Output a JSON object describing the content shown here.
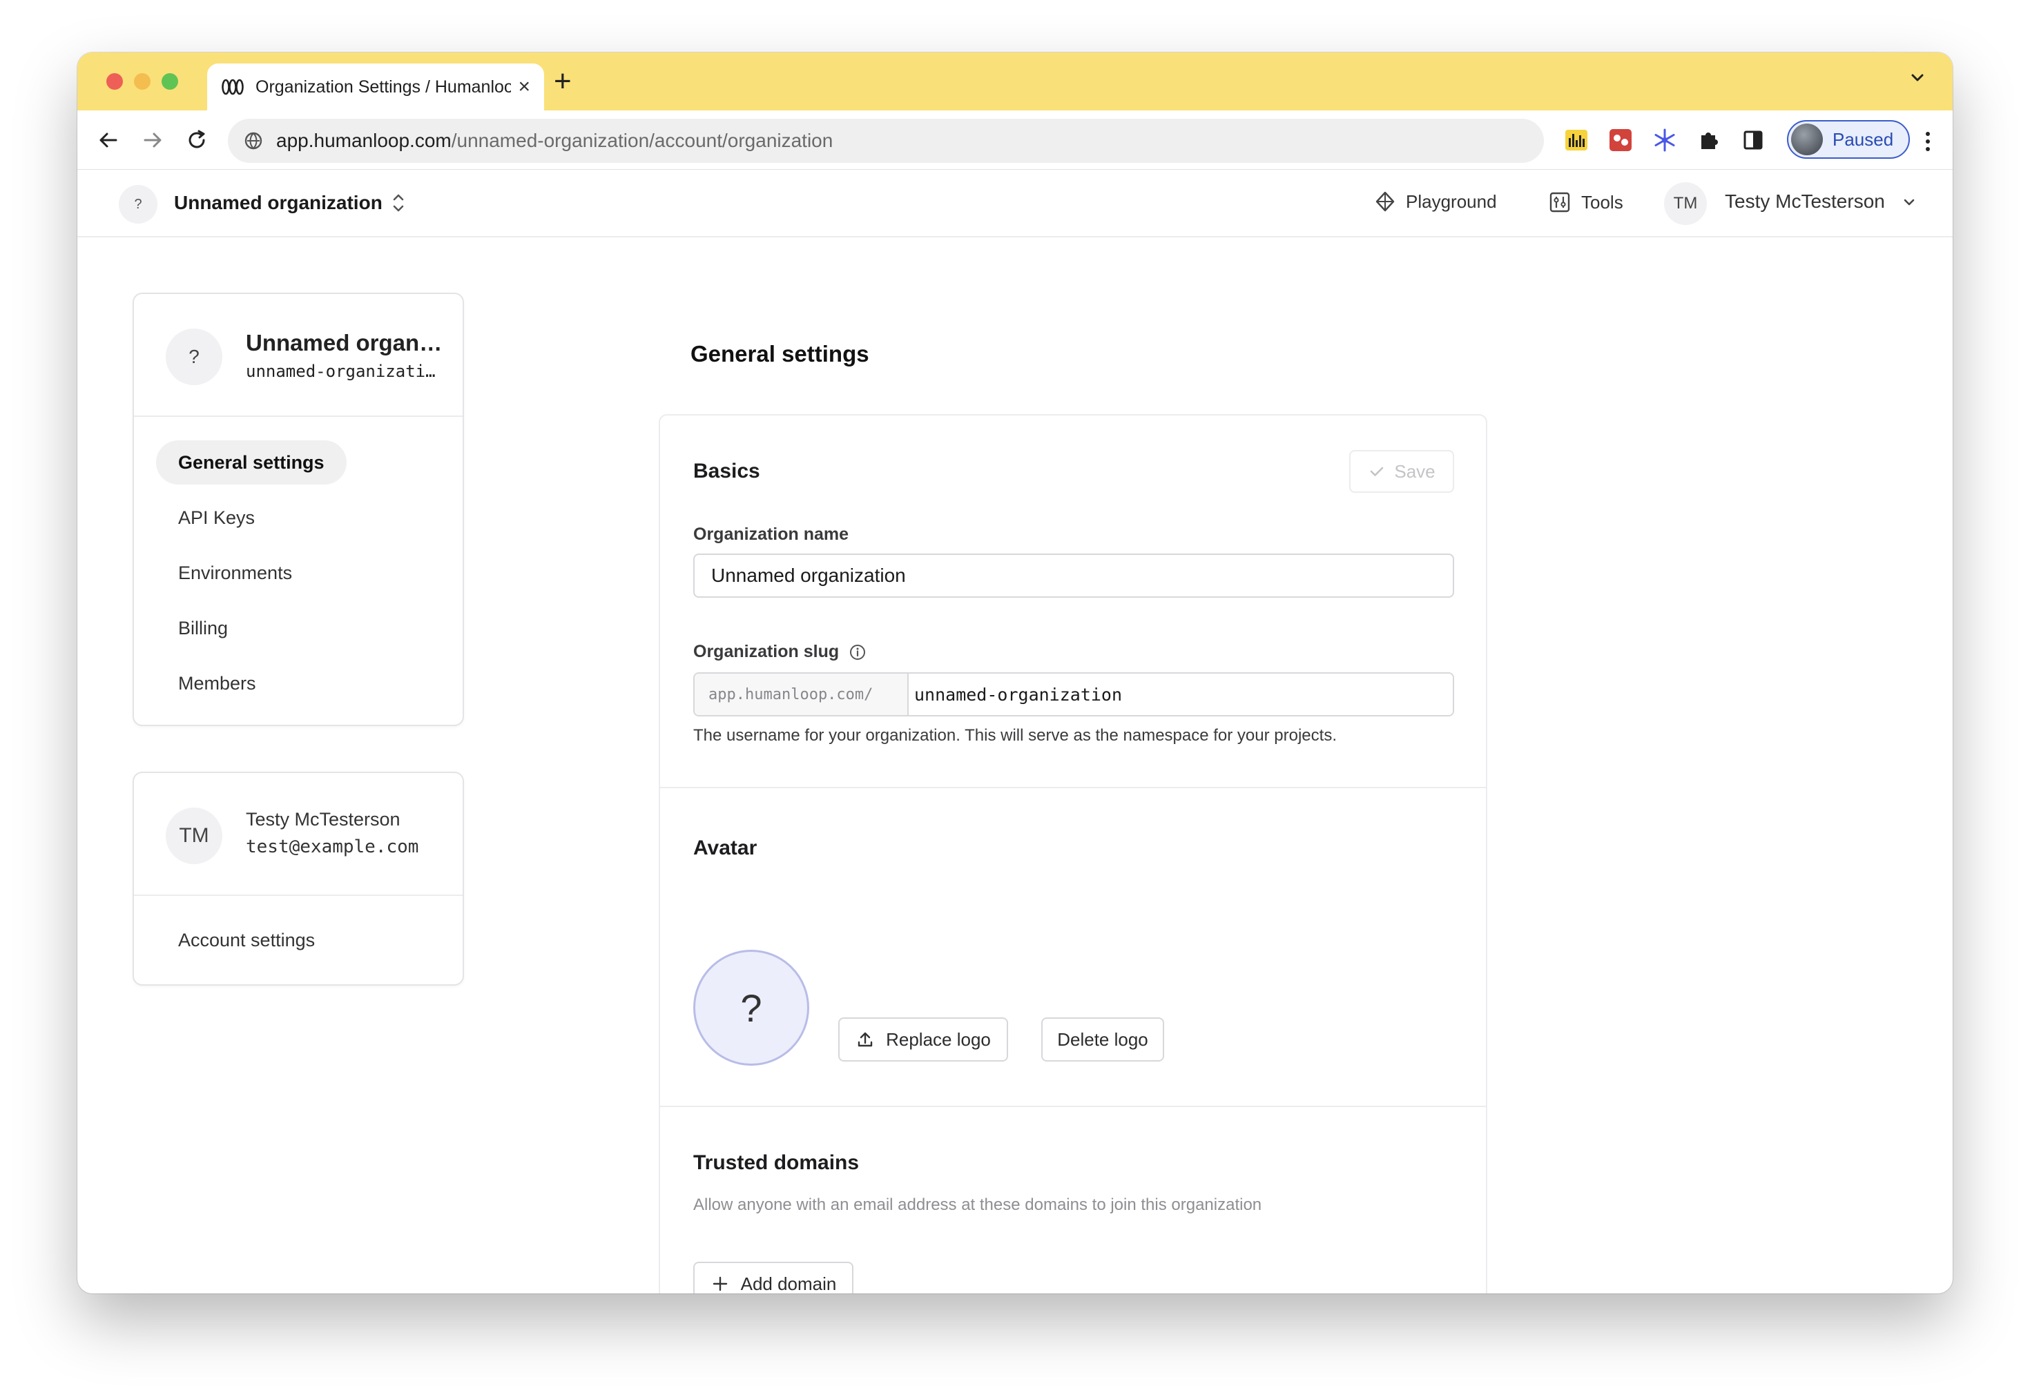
{
  "colors": {
    "tabbar_bg": "#fae078",
    "profile_accent": "#2a4bb3",
    "active_nav_bg": "#f0f0f1"
  },
  "browser": {
    "tab_title": "Organization Settings / Humanloop",
    "url_host": "app.humanloop.com",
    "url_path": "/unnamed-organization/account/organization",
    "profile_label": "Paused"
  },
  "header": {
    "org_badge": "?",
    "org_name": "Unnamed organization",
    "playground_label": "Playground",
    "tools_label": "Tools",
    "user_initials": "TM",
    "user_name": "Testy McTesterson"
  },
  "sidebar": {
    "org_card": {
      "avatar": "?",
      "title": "Unnamed organization",
      "slug": "unnamed-organization"
    },
    "items": [
      {
        "label": "General settings",
        "active": true
      },
      {
        "label": "API Keys",
        "active": false
      },
      {
        "label": "Environments",
        "active": false
      },
      {
        "label": "Billing",
        "active": false
      },
      {
        "label": "Members",
        "active": false
      }
    ],
    "user_card": {
      "initials": "TM",
      "name": "Testy McTesterson",
      "email": "test@example.com",
      "account_settings": "Account settings"
    }
  },
  "main": {
    "title": "General settings",
    "basics": {
      "heading": "Basics",
      "save_label": "Save",
      "org_name_label": "Organization name",
      "org_name_value": "Unnamed organization",
      "slug_label": "Organization slug",
      "slug_prefix": "app.humanloop.com/",
      "slug_value": "unnamed-organization",
      "slug_help": "The username for your organization. This will serve as the namespace for your projects."
    },
    "avatar": {
      "heading": "Avatar",
      "placeholder": "?",
      "replace_label": "Replace logo",
      "delete_label": "Delete logo"
    },
    "trusted_domains": {
      "heading": "Trusted domains",
      "description": "Allow anyone with an email address at these domains to join this organization",
      "add_label": "Add domain"
    }
  }
}
